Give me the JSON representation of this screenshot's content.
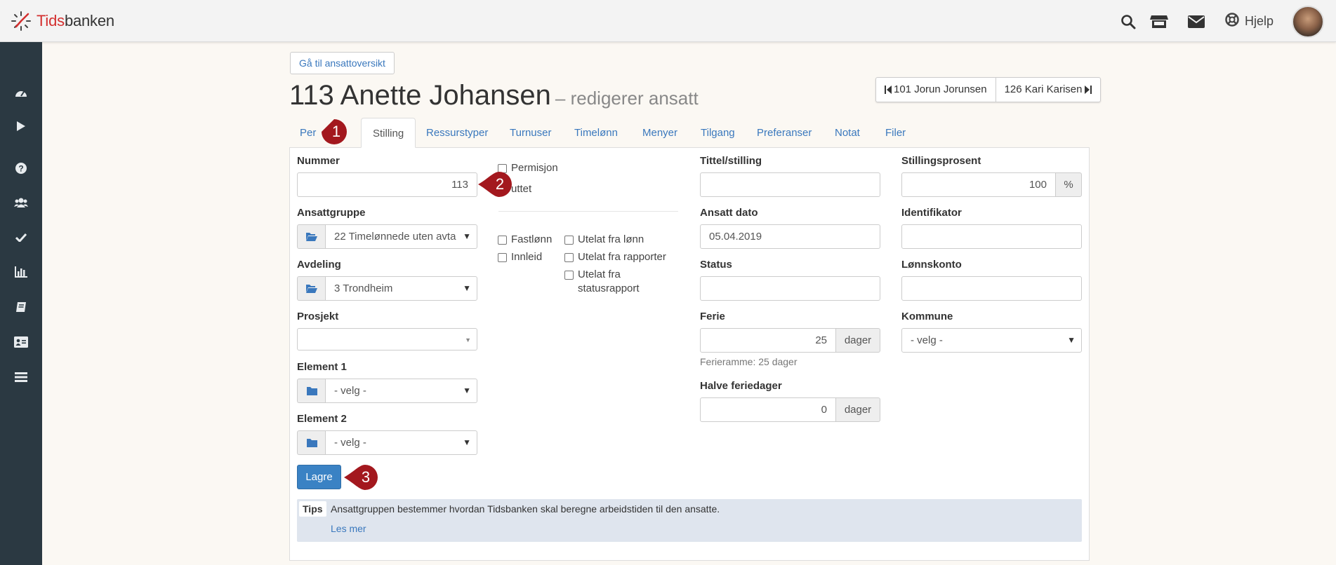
{
  "app": {
    "logo_prefix": "Tids",
    "logo_suffix": "banken"
  },
  "topbar": {
    "icons": [
      "search-icon",
      "store-icon",
      "mail-icon"
    ],
    "help_label": "Hjelp"
  },
  "sidebar": {
    "items": [
      "dashboard-icon",
      "play-icon",
      "question-icon",
      "users-icon",
      "check-icon",
      "chart-icon",
      "book-icon",
      "id-card-icon",
      "list-icon"
    ]
  },
  "header": {
    "back_button": "Gå til ansattoversikt",
    "title": "113 Anette Johansen",
    "subtitle": "– redigerer ansatt",
    "prev_employee": "101 Jorun Jorunsen",
    "next_employee": "126 Kari Karisen"
  },
  "tabs": [
    {
      "label": "Per"
    },
    {
      "label": "Stilling"
    },
    {
      "label": "Ressurstyper"
    },
    {
      "label": "Turnuser"
    },
    {
      "label": "Timelønn"
    },
    {
      "label": "Menyer"
    },
    {
      "label": "Tilgang"
    },
    {
      "label": "Preferanser"
    },
    {
      "label": "Notat"
    },
    {
      "label": "Filer"
    }
  ],
  "form": {
    "nummer_label": "Nummer",
    "nummer_value": "113",
    "ansattgruppe_label": "Ansattgruppe",
    "ansattgruppe_value": "22 Timelønnede uten avta",
    "avdeling_label": "Avdeling",
    "avdeling_value": "3 Trondheim",
    "prosjekt_label": "Prosjekt",
    "prosjekt_value": "",
    "element1_label": "Element 1",
    "element1_value": "- velg -",
    "element2_label": "Element 2",
    "element2_value": "- velg -",
    "permisjon_label": "Permisjon",
    "sluttet_label": "uttet",
    "fastlonn_label": "Fastlønn",
    "innleid_label": "Innleid",
    "utelat_lonn_label": "Utelat fra lønn",
    "utelat_rapporter_label": "Utelat fra rapporter",
    "utelat_status_label1": "Utelat fra",
    "utelat_status_label2": "statusrapport",
    "tittel_label": "Tittel/stilling",
    "tittel_value": "",
    "ansatt_dato_label": "Ansatt dato",
    "ansatt_dato_value": "05.04.2019",
    "status_label": "Status",
    "status_value": "",
    "ferie_label": "Ferie",
    "ferie_value": "25",
    "ferie_unit": "dager",
    "ferieramme_text": "Ferieramme: 25 dager",
    "halve_label": "Halve feriedager",
    "halve_value": "0",
    "halve_unit": "dager",
    "stillingsprosent_label": "Stillingsprosent",
    "stillingsprosent_value": "100",
    "stillingsprosent_unit": "%",
    "identifikator_label": "Identifikator",
    "identifikator_value": "",
    "lonnskonto_label": "Lønnskonto",
    "lonnskonto_value": "",
    "kommune_label": "Kommune",
    "kommune_value": "- velg -",
    "save_label": "Lagre"
  },
  "tips": {
    "label": "Tips",
    "text": "Ansattgruppen bestemmer hvordan Tidsbanken skal beregne arbeidstiden til den ansatte.",
    "link": "Les mer"
  },
  "markers": {
    "m1": "1",
    "m2": "2",
    "m3": "3"
  },
  "colors": {
    "accent": "#3a78bd",
    "sidebar": "#2b3942",
    "marker": "#a3181e",
    "brand_red": "#d32f2f"
  }
}
